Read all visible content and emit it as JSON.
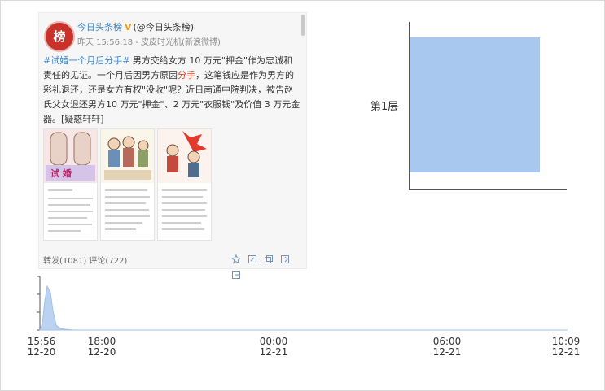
{
  "post": {
    "avatar_char": "榜",
    "username": "今日头条榜",
    "verified_mark": "V",
    "handle": "(@今日头条榜)",
    "meta": "昨天 15:56:18 - 皮皮时光机(新浪微博)",
    "text": {
      "hashtag": "#试婚一个月后分手#",
      "p1": " 男方交给女方 10 万元\"押金\"作为忠诚和责任的见证。一个月后因男方原因",
      "hl": "分手",
      "p2": "，这笔钱应是作为男方的彩礼退还，还是女方有权\"没收\"呢？近日南通中院判决，被告赵氏父女退还男方10 万元\"押金\"、2 万元\"衣服钱\"及价值 3 万元金器。[疑惑轩轩]"
    },
    "thumb1_caption": "试 婚",
    "stats": "转发(1081)  评论(722)",
    "actions": [
      "star-icon",
      "edit-icon",
      "copy-icon",
      "export-icon",
      "share-icon"
    ]
  },
  "layer_chart": {
    "label": "第1层",
    "value": 1
  },
  "timeline": {
    "ticks": [
      {
        "time": "15:56",
        "date": "12-20"
      },
      {
        "time": "18:00",
        "date": "12-20"
      },
      {
        "time": "00:00",
        "date": "12-21"
      },
      {
        "time": "06:00",
        "date": "12-21"
      },
      {
        "time": "10:09",
        "date": "12-21"
      }
    ]
  },
  "chart_data": {
    "type": "area",
    "title": "",
    "xlabel": "",
    "ylabel": "",
    "x": [
      "15:56 12-20",
      "18:00 12-20",
      "00:00 12-21",
      "06:00 12-21",
      "10:09 12-21"
    ],
    "series": [
      {
        "values": [
          0.85,
          0.02,
          0.01,
          0.01,
          0.0
        ]
      }
    ],
    "colors": {
      "fill": "#b9d3f1",
      "stroke": "#9fc0ea"
    }
  }
}
